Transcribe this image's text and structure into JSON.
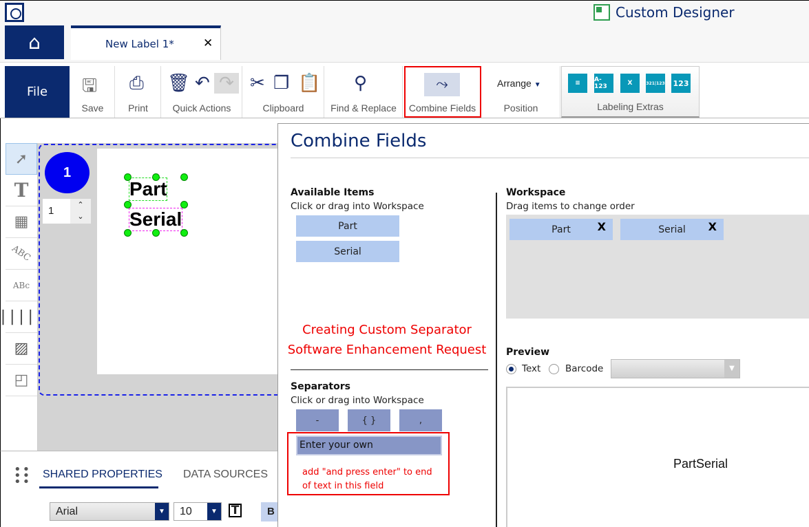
{
  "app": {
    "title": "Custom Designer",
    "logo_icon": "app-logo-icon"
  },
  "tabs": [
    {
      "label": "New Label 1*",
      "close": "✕"
    }
  ],
  "ribbon": {
    "file": "File",
    "groups": [
      {
        "label": "Save"
      },
      {
        "label": "Print"
      },
      {
        "label": "Quick Actions"
      },
      {
        "label": "Clipboard"
      },
      {
        "label": "Find & Replace"
      },
      {
        "label": "Combine Fields"
      },
      {
        "label": "Position",
        "dropdown": "Arrange"
      },
      {
        "label": "Labeling Extras"
      }
    ],
    "extras_icons": [
      "A-123",
      "321|123",
      "123"
    ]
  },
  "canvas": {
    "label_number": "1",
    "copy_count": "1",
    "objects": [
      "Part",
      "Serial"
    ]
  },
  "bottom_panel": {
    "tabs": [
      "SHARED PROPERTIES",
      "DATA SOURCES"
    ],
    "font": "Arial",
    "size": "10",
    "bold": "B"
  },
  "dialog": {
    "title": "Combine Fields",
    "available": {
      "heading": "Available Items",
      "hint": "Click or drag into Workspace",
      "items": [
        "Part",
        "Serial"
      ]
    },
    "workspace": {
      "heading": "Workspace",
      "hint": "Drag items to change order",
      "items": [
        "Part",
        "Serial"
      ],
      "remove": "X"
    },
    "annotation": [
      "Creating Custom Separator",
      "Software Enhancement Request"
    ],
    "separators": {
      "heading": "Separators",
      "hint": "Click or drag into Workspace",
      "items": [
        "-",
        "{ }",
        ","
      ],
      "custom_placeholder": "Enter your own"
    },
    "custom_note": [
      "add \"and press enter\" to end",
      "of text in this field"
    ],
    "preview": {
      "heading": "Preview",
      "options": [
        "Text",
        "Barcode"
      ],
      "selected": "Text",
      "value": "PartSerial"
    }
  },
  "colors": {
    "brand": "#0b2a6f",
    "chip": "#b3cbf0",
    "separator": "#8796c6",
    "annotation": "#ee0000"
  }
}
